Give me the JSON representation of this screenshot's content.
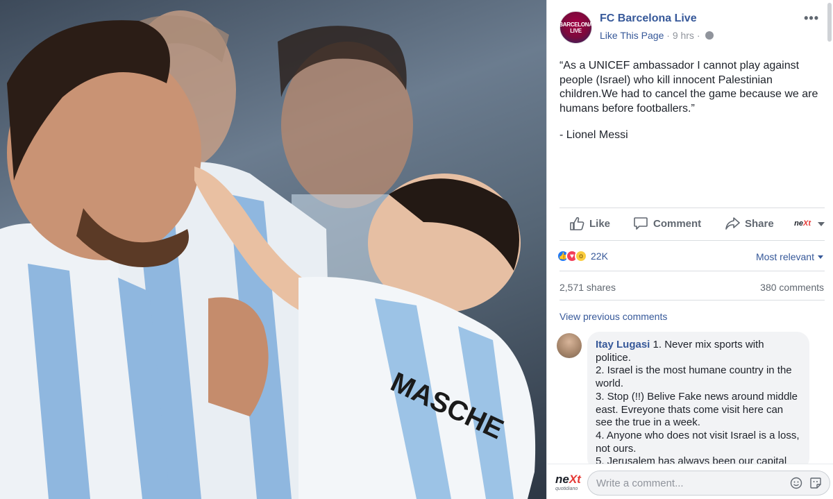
{
  "post": {
    "page_name": "FC Barcelona Live",
    "avatar_text_line1": "BARCELONA",
    "avatar_text_line2": "LIVE",
    "like_page": "Like This Page",
    "separator": " · ",
    "time": "9 hrs",
    "separator2": " · ",
    "more_label": "•••",
    "text": "“As a UNICEF ambassador I cannot play against people (Israel) who kill innocent Palestinian children.We had to cancel the game because we are humans before footballers.”",
    "author": "- Lionel Messi"
  },
  "actions": {
    "like": "Like",
    "comment": "Comment",
    "share": "Share",
    "next_logo_a": "ne",
    "next_logo_b": "Xt"
  },
  "stats": {
    "reaction_count": "22K",
    "most_relevant": "Most relevant",
    "shares": "2,571 shares",
    "comments": "380 comments"
  },
  "comments": {
    "view_previous": "View previous comments",
    "items": [
      {
        "name": "Itay Lugasi",
        "lines": [
          " 1. Never mix sports with politice.",
          "2. Israel is the most humane country in the world.",
          "3. Stop (!!) Belive Fake news around middle east. Evreyone thats come visit here can see the true in a week.",
          "4. Anyone who does not visit Israel is a loss, not ours.",
          "5. Jerusalem has always been our capital"
        ]
      }
    ]
  },
  "composer": {
    "placeholder": "Write a comment...",
    "logo_a": "ne",
    "logo_b": "Xt",
    "logo_sub": "quotidiano"
  },
  "colors": {
    "link": "#365899",
    "secondary_text": "#90949c",
    "bubble": "#f2f3f5"
  },
  "icons": [
    "thumbs-up-icon",
    "comment-icon",
    "share-icon",
    "globe-icon",
    "emoji-icon",
    "sticker-icon"
  ]
}
